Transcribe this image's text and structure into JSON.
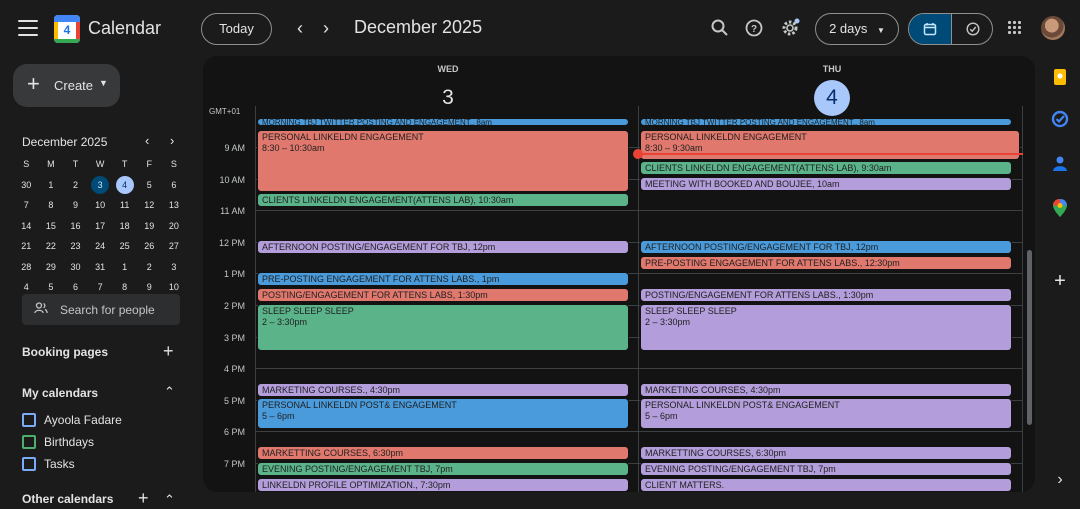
{
  "app": {
    "title": "Calendar",
    "logo_day": "4"
  },
  "toolbar": {
    "today_label": "Today",
    "prev_icon": "‹",
    "next_icon": "›",
    "month_title": "December 2025",
    "view_label": "2 days"
  },
  "sidebar": {
    "create_label": "Create",
    "mini_month": "December 2025",
    "weekdays": [
      "S",
      "M",
      "T",
      "W",
      "T",
      "F",
      "S"
    ],
    "weeks": [
      [
        "30",
        "1",
        "2",
        "3",
        "4",
        "5",
        "6"
      ],
      [
        "7",
        "8",
        "9",
        "10",
        "11",
        "12",
        "13"
      ],
      [
        "14",
        "15",
        "16",
        "17",
        "18",
        "19",
        "20"
      ],
      [
        "21",
        "22",
        "23",
        "24",
        "25",
        "26",
        "27"
      ],
      [
        "28",
        "29",
        "30",
        "31",
        "1",
        "2",
        "3"
      ],
      [
        "4",
        "5",
        "6",
        "7",
        "8",
        "9",
        "10"
      ]
    ],
    "search_placeholder": "Search for people",
    "booking_pages": "Booking pages",
    "my_calendars": "My calendars",
    "calendars": [
      {
        "name": "Ayoola Fadare",
        "color": "#7baaf7"
      },
      {
        "name": "Birthdays",
        "color": "#4caf6e"
      },
      {
        "name": "Tasks",
        "color": "#7baaf7"
      }
    ],
    "other_calendars": "Other calendars"
  },
  "grid": {
    "timezone": "GMT+01",
    "days": [
      {
        "dow": "WED",
        "num": "3"
      },
      {
        "dow": "THU",
        "num": "4"
      }
    ],
    "hours": [
      "9 AM",
      "10 AM",
      "11 AM",
      "12 PM",
      "1 PM",
      "2 PM",
      "3 PM",
      "4 PM",
      "5 PM",
      "6 PM",
      "7 PM"
    ]
  },
  "colors": {
    "blue": "#4a9bdb",
    "red": "#e0786d",
    "green": "#5bb38a",
    "purple": "#b39ddb"
  },
  "events": {
    "wed": [
      {
        "title": "MORNING TBJ TWITTER POSTING AND ENGAGEMENT.",
        "time": ", 8am"
      },
      {
        "title": "PERSONAL LINKELDN ENGAGEMENT",
        "time": "8:30 – 10:30am"
      },
      {
        "title": "CLIENTS LINKELDN ENGAGEMENT(ATTENS LAB)",
        "time": ", 10:30am"
      },
      {
        "title": "AFTERNOON POSTING/ENGAGEMENT FOR TBJ",
        "time": ", 12pm"
      },
      {
        "title": "PRE-POSTING ENGAGEMENT FOR ATTENS LABS.",
        "time": ", 1pm"
      },
      {
        "title": "POSTING/ENGAGEMENT FOR ATTENS LABS",
        "time": ", 1:30pm"
      },
      {
        "title": "SLEEP SLEEP SLEEP",
        "time": "2 – 3:30pm"
      },
      {
        "title": "MARKETING COURSES.",
        "time": ", 4:30pm"
      },
      {
        "title": "PERSONAL LINKELDN POST& ENGAGEMENT",
        "time": "5 – 6pm"
      },
      {
        "title": "MARKETTING COURSES",
        "time": ", 6:30pm"
      },
      {
        "title": "EVENING POSTING/ENGAGEMENT TBJ",
        "time": ", 7pm"
      },
      {
        "title": "LINKELDN PROFILE OPTIMIZATION.",
        "time": ", 7:30pm"
      }
    ],
    "thu": [
      {
        "title": "MORNING TBJ TWITTER POSTING AND ENGAGEMENT.",
        "time": ", 8am"
      },
      {
        "title": "PERSONAL LINKELDN ENGAGEMENT",
        "time": "8:30 – 9:30am"
      },
      {
        "title": "CLIENTS LINKELDN ENGAGEMENT(ATTENS LAB)",
        "time": ", 9:30am"
      },
      {
        "title": "MEETING WITH BOOKED AND BOUJEE",
        "time": ", 10am"
      },
      {
        "title": "AFTERNOON POSTING/ENGAGEMENT FOR TBJ",
        "time": ", 12pm"
      },
      {
        "title": "PRE-POSTING ENGAGEMENT FOR ATTENS LABS.",
        "time": ", 12:30pm"
      },
      {
        "title": "POSTING/ENGAGEMENT FOR ATTENS LABS.",
        "time": ", 1:30pm"
      },
      {
        "title": "SLEEP SLEEP SLEEP",
        "time": "2 – 3:30pm"
      },
      {
        "title": "MARKETING COURSES",
        "time": ", 4:30pm"
      },
      {
        "title": "PERSONAL LINKELDN POST& ENGAGEMENT",
        "time": "5 – 6pm"
      },
      {
        "title": "MARKETTING COURSES",
        "time": ", 6:30pm"
      },
      {
        "title": "EVENING POSTING/ENGAGEMENT TBJ",
        "time": ", 7pm"
      },
      {
        "title": "CLIENT MATTERS.",
        "time": ""
      }
    ]
  }
}
